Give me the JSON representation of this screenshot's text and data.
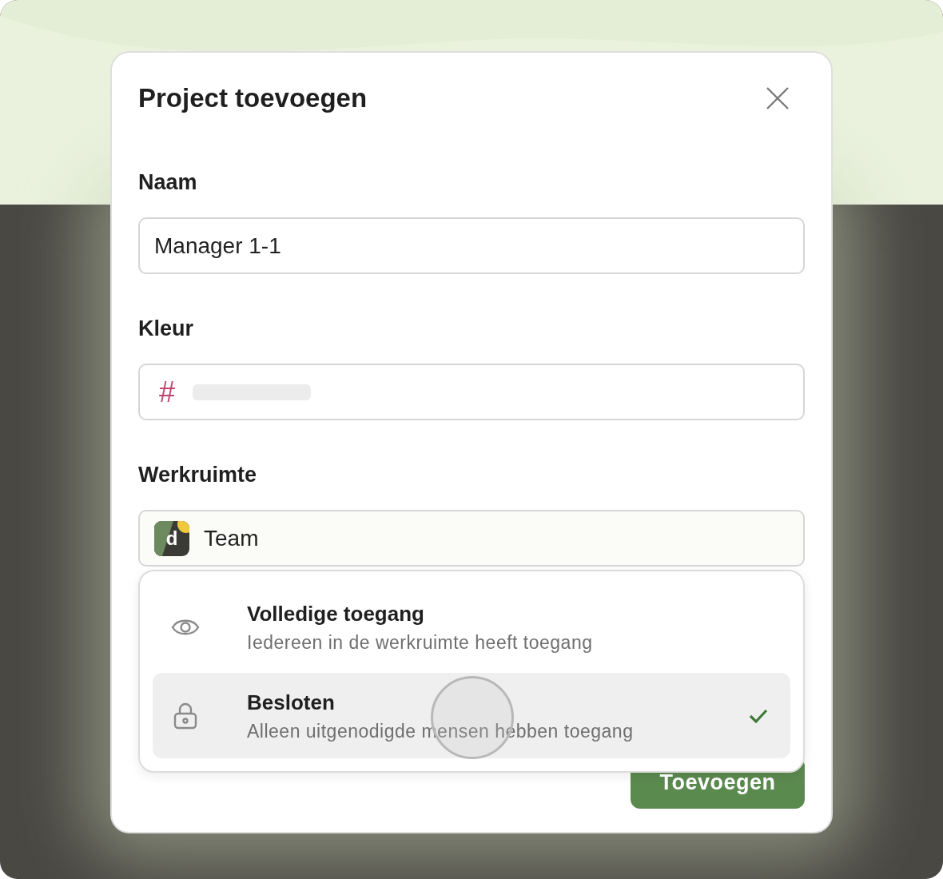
{
  "dialog": {
    "title": "Project toevoegen"
  },
  "fields": [
    {
      "label": "Naam",
      "kind": "text",
      "value": "Manager 1-1"
    },
    {
      "label": "Kleur",
      "kind": "color",
      "prefix": "#"
    },
    {
      "label": "Werkruimte",
      "kind": "select",
      "value": "Team",
      "logo_letter": "d"
    }
  ],
  "access_menu": {
    "options": [
      {
        "kind": "eye",
        "title": "Volledige toegang",
        "description": "Iedereen in de werkruimte heeft toegang",
        "selected": false
      },
      {
        "kind": "lock",
        "title": "Besloten",
        "description": "Alleen uitgenodigde mensen hebben toegang",
        "selected": true
      }
    ]
  },
  "submit": {
    "label": "Toevoegen"
  }
}
